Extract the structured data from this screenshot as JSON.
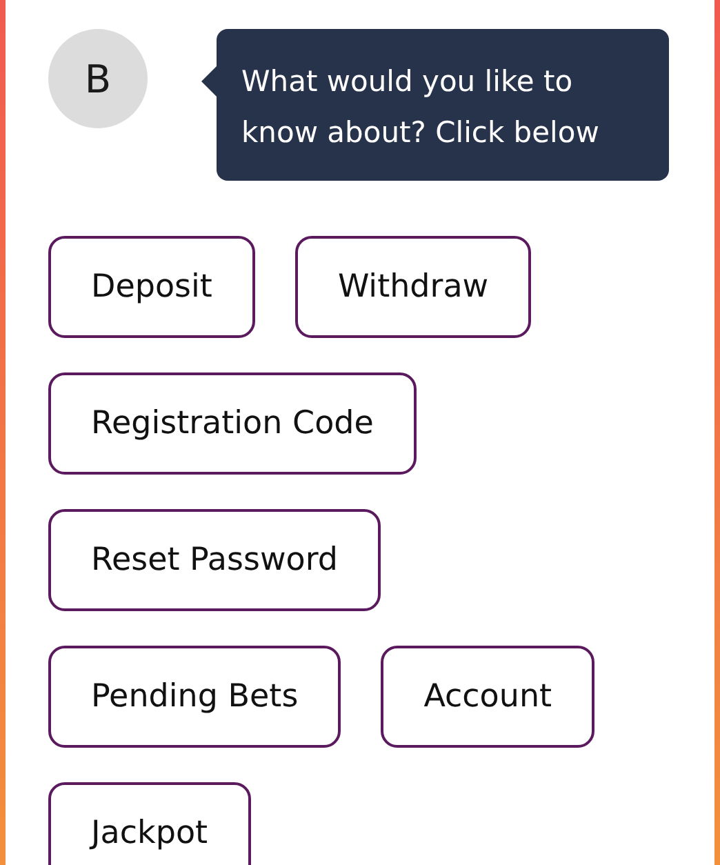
{
  "avatar": {
    "initial": "B"
  },
  "message": {
    "text": "What would you like to know about? Click below"
  },
  "options": [
    {
      "label": "Deposit"
    },
    {
      "label": "Withdraw"
    },
    {
      "label": "Registration Code"
    },
    {
      "label": "Reset Password"
    },
    {
      "label": "Pending Bets"
    },
    {
      "label": "Account"
    },
    {
      "label": "Jackpot"
    }
  ]
}
